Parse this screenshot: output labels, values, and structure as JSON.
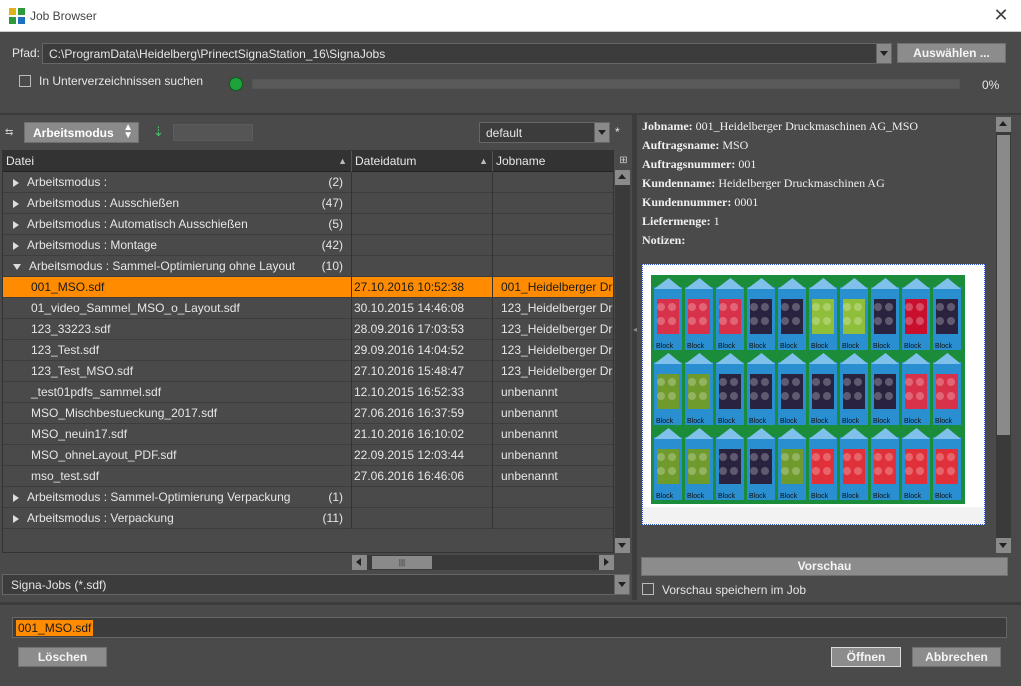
{
  "window": {
    "title": "Job Browser",
    "close_glyph": "✕"
  },
  "path": {
    "label": "Pfad:",
    "value": "C:\\ProgramData\\Heidelberg\\PrinectSignaStation_16\\SignaJobs",
    "select_button": "Auswählen ..."
  },
  "search": {
    "subdirs_label": "In Unterverzeichnissen suchen",
    "subdirs_checked": false,
    "progress_percent": 0,
    "progress_text": "0%"
  },
  "toolbar": {
    "group_mode": "Arbeitsmodus",
    "filter_value": "",
    "view_preset": "default",
    "asterisk": "*"
  },
  "table": {
    "columns": [
      "Datei",
      "Dateidatum",
      "Jobname"
    ],
    "rows": [
      {
        "kind": "group",
        "open": false,
        "label": "Arbeitsmodus :",
        "count": "(2)"
      },
      {
        "kind": "group",
        "open": false,
        "label": "Arbeitsmodus : Ausschießen",
        "count": "(47)"
      },
      {
        "kind": "group",
        "open": false,
        "label": "Arbeitsmodus : Automatisch Ausschießen",
        "count": "(5)"
      },
      {
        "kind": "group",
        "open": false,
        "label": "Arbeitsmodus : Montage",
        "count": "(42)"
      },
      {
        "kind": "group",
        "open": true,
        "label": "Arbeitsmodus : Sammel-Optimierung ohne Layout",
        "count": "(10)"
      },
      {
        "kind": "file",
        "selected": true,
        "file": "001_MSO.sdf",
        "date": "27.10.2016 10:52:38",
        "job": "001_Heidelberger Dr"
      },
      {
        "kind": "file",
        "file": "01_video_Sammel_MSO_o_Layout.sdf",
        "date": "30.10.2015 14:46:08",
        "job": "123_Heidelberger Dr"
      },
      {
        "kind": "file",
        "file": "123_33223.sdf",
        "date": "28.09.2016 17:03:53",
        "job": "123_Heidelberger Dr"
      },
      {
        "kind": "file",
        "file": "123_Test.sdf",
        "date": "29.09.2016 14:04:52",
        "job": "123_Heidelberger Dr"
      },
      {
        "kind": "file",
        "file": "123_Test_MSO.sdf",
        "date": "27.10.2016 15:48:47",
        "job": "123_Heidelberger Dr"
      },
      {
        "kind": "file",
        "file": "_test01pdfs_sammel.sdf",
        "date": "12.10.2015 16:52:33",
        "job": "unbenannt"
      },
      {
        "kind": "file",
        "file": "MSO_Mischbestueckung_2017.sdf",
        "date": "27.06.2016 16:37:59",
        "job": "unbenannt"
      },
      {
        "kind": "file",
        "file": "MSO_neuin17.sdf",
        "date": "21.10.2016 16:10:02",
        "job": "unbenannt"
      },
      {
        "kind": "file",
        "file": "MSO_ohneLayout_PDF.sdf",
        "date": "22.09.2015 12:03:44",
        "job": "unbenannt"
      },
      {
        "kind": "file",
        "file": "mso_test.sdf",
        "date": "27.06.2016 16:46:06",
        "job": "unbenannt"
      },
      {
        "kind": "group",
        "open": false,
        "label": "Arbeitsmodus : Sammel-Optimierung Verpackung",
        "count": "(1)"
      },
      {
        "kind": "group",
        "open": false,
        "label": "Arbeitsmodus : Verpackung",
        "count": "(11)"
      }
    ]
  },
  "file_type": "Signa-Jobs (*.sdf)",
  "details": [
    {
      "key": "Jobname:",
      "value": "001_Heidelberger Druckmaschinen AG_MSO"
    },
    {
      "key": "Auftragsname:",
      "value": "MSO"
    },
    {
      "key": "Auftragsnummer:",
      "value": "001"
    },
    {
      "key": "Kundenname:",
      "value": "Heidelberger Druckmaschinen AG"
    },
    {
      "key": "Kundennummer:",
      "value": "0001"
    },
    {
      "key": "Liefermenge:",
      "value": "1"
    },
    {
      "key": "Notizen:",
      "value": ""
    }
  ],
  "preview": {
    "button": "Vorschau",
    "save_label": "Vorschau speichern im Job",
    "save_checked": false,
    "packet_label": "Block",
    "fruit_columns": [
      "raspberry",
      "raspberry",
      "blackberry",
      "blackberry",
      "gooseberry",
      "gooseberry",
      "blackberry",
      "redcurrant",
      "redcurrant",
      "blackberry"
    ],
    "fruit_rows": [
      [
        "raspberry",
        "raspberry",
        "raspberry",
        "blackberry",
        "blackberry",
        "gooseberry",
        "gooseberry",
        "blackberry",
        "redcurrant",
        "blackberry"
      ],
      [
        "kiwi",
        "kiwi",
        "blackberry",
        "blackberry",
        "blackberry",
        "blackberry",
        "blackberry",
        "blackberry",
        "raspberry",
        "raspberry"
      ],
      [
        "kiwi",
        "kiwi",
        "blackberry",
        "blackberry",
        "kiwi",
        "strawberry",
        "strawberry",
        "strawberry",
        "strawberry",
        "strawberry"
      ]
    ],
    "fruit_colors": {
      "raspberry": "#d8324a",
      "blackberry": "#2a2340",
      "gooseberry": "#8fbf3a",
      "redcurrant": "#c8102e",
      "kiwi": "#6f9a2c",
      "strawberry": "#e0303a"
    }
  },
  "filename": "001_MSO.sdf",
  "buttons": {
    "delete": "Löschen",
    "open": "Öffnen",
    "cancel": "Abbrechen"
  },
  "colors": {
    "selection": "#ff8c00",
    "led": "#1fa23a",
    "preview_border": "#2b55c8"
  }
}
